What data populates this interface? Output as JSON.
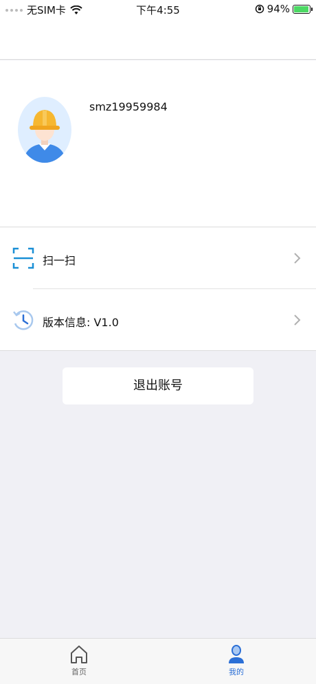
{
  "status_bar": {
    "carrier": "无SIM卡",
    "time": "下午4:55",
    "battery": "94%"
  },
  "profile": {
    "username": "smz19959984"
  },
  "menu": {
    "scan_label": "扫一扫",
    "version_label": "版本信息:  V1.0"
  },
  "logout_label": "退出账号",
  "tabs": {
    "home": "首页",
    "mine": "我的"
  },
  "colors": {
    "accent": "#2b6fd6",
    "scan_icon": "#1a8fd6",
    "version_icon": "#4a90e2"
  }
}
